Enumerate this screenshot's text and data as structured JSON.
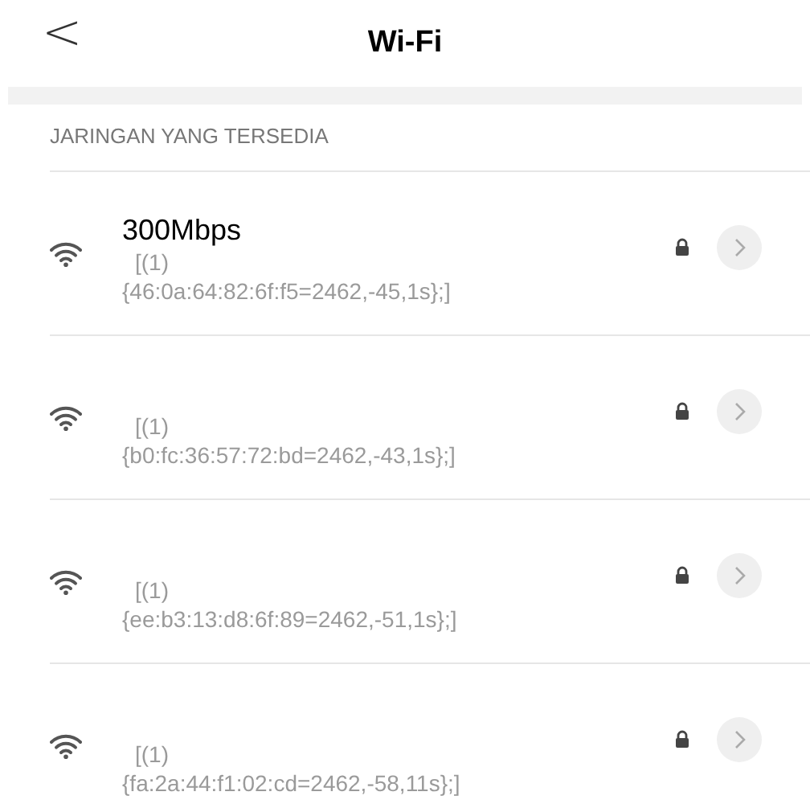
{
  "header": {
    "back": "<",
    "title": "Wi-Fi"
  },
  "section": {
    "label": "JARINGAN YANG TERSEDIA"
  },
  "networks": [
    {
      "name": "300Mbps",
      "line_1": "[(1)",
      "line_2": "{46:0a:64:82:6f:f5=2462,-45,1s};]",
      "locked": true
    },
    {
      "line_1": "[(1)",
      "line_2": "{b0:fc:36:57:72:bd=2462,-43,1s};]",
      "locked": true
    },
    {
      "line_1": "[(1)",
      "line_2": "{ee:b3:13:d8:6f:89=2462,-51,1s};]",
      "locked": true
    },
    {
      "line_1": "[(1)",
      "line_2": "{fa:2a:44:f1:02:cd=2462,-58,11s};]",
      "locked": true
    }
  ]
}
